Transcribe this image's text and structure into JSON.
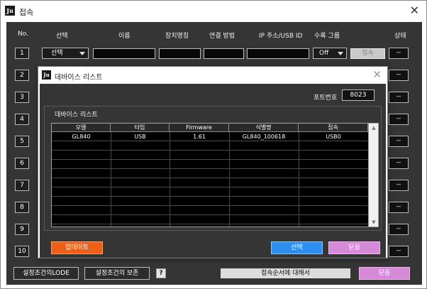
{
  "window": {
    "icon_glyph": "Ju",
    "title": "접속",
    "close_glyph": "✕"
  },
  "headers": {
    "no": "No.",
    "select": "선택",
    "name": "이름",
    "device_name": "장치명칭",
    "connection": "연결 방법",
    "ip": "IP 주소/USB ID",
    "recording_group": "수록 그룹",
    "status": "상태"
  },
  "rows": [
    {
      "number": "1",
      "select_value": "선택",
      "group_value": "Off",
      "connect_label": "접속",
      "status": "--"
    },
    {
      "number": "2",
      "status": "--"
    },
    {
      "number": "3",
      "status": "--"
    },
    {
      "number": "4",
      "status": "--"
    },
    {
      "number": "5",
      "status": "--"
    },
    {
      "number": "6",
      "status": "--"
    },
    {
      "number": "7",
      "status": "--"
    },
    {
      "number": "8",
      "status": "--"
    },
    {
      "number": "9",
      "status": "--"
    },
    {
      "number": "10",
      "status": "--"
    }
  ],
  "bottom": {
    "load_label": "설정조건의LODE",
    "save_label": "설정조건의 보존",
    "help_label": "?",
    "order_label": "접속순서에 대해서",
    "close_label": "닫음"
  },
  "dialog": {
    "icon_glyph": "Ju",
    "title": "데바이스 리스트",
    "close_glyph": "✕",
    "port_label": "포트번호",
    "port_value": "8023",
    "group_label": "데바이스 리스트",
    "table": {
      "columns": [
        "모델",
        "타입",
        "Firmware",
        "식별명",
        "접속"
      ],
      "rows": [
        [
          "GL840",
          "USB",
          "1.61",
          "GL840_100618",
          "USB0"
        ]
      ]
    },
    "scroll_up_glyph": "▲",
    "scroll_down_glyph": "▼",
    "update_label": "업데이트",
    "select_label": "선택",
    "close_label": "닫음"
  },
  "colors": {
    "panel_bg": "#353535",
    "update_button": "#ee5e18",
    "select_button": "#2d8ef0",
    "close_button": "#d48ad6"
  }
}
